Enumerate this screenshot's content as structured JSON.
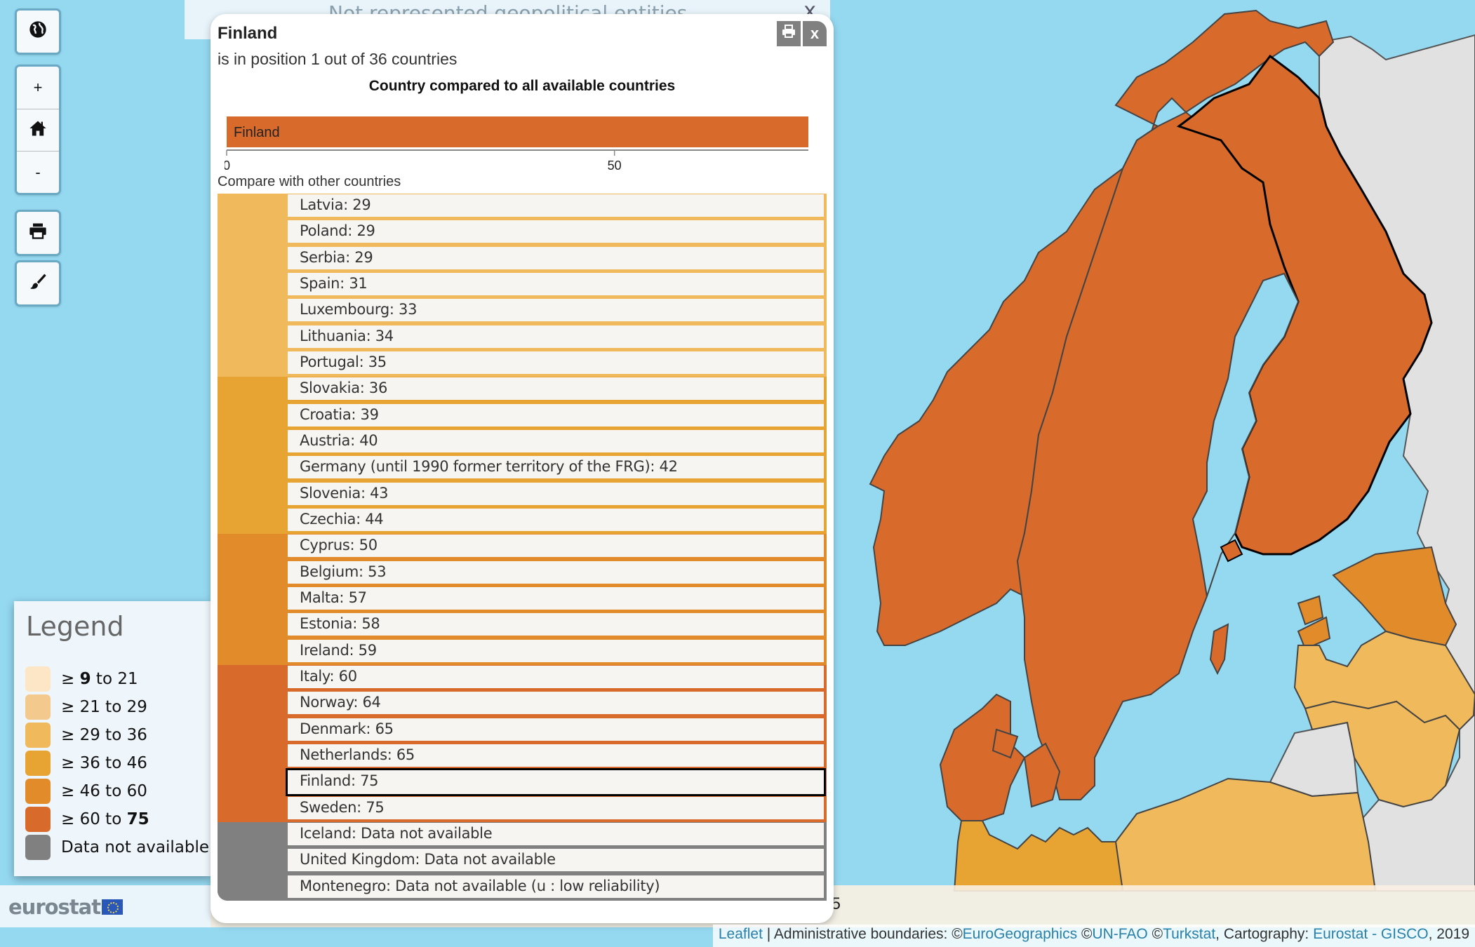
{
  "colors": {
    "sea": "#95d9f1",
    "no_data_land": "#e1e1e1",
    "class_colors": [
      "#fce6c5",
      "#f4c98e",
      "#efb95c",
      "#e8a433",
      "#e18b2a",
      "#d86a2c",
      "#808080"
    ],
    "selected_outline": "#000000",
    "accent": "#d86a2c"
  },
  "map_controls": {
    "globe_icon": "globe-icon",
    "zoom_in_label": "+",
    "home_icon": "home-icon",
    "zoom_out_label": "-",
    "print_icon": "print-icon",
    "style_icon": "paintbrush-icon"
  },
  "background_panel": {
    "text": "Not represented geopolitical entities",
    "close_label": "x"
  },
  "popup": {
    "title": "Finland",
    "subtitle": "is in position 1 out of 36 countries",
    "print_icon": "print-icon",
    "close_label": "x",
    "chart_title": "Country compared to all available countries",
    "compare_label": "Compare with other countries"
  },
  "chart_data": {
    "type": "bar",
    "title": "Country compared to all available countries",
    "categories": [
      "Finland"
    ],
    "values": [
      75
    ],
    "xlim": [
      0,
      75
    ],
    "ticks": [
      0,
      50
    ],
    "xlabel": "",
    "ylabel": ""
  },
  "compare_list": [
    {
      "label": "Latvia: 29",
      "class": 2
    },
    {
      "label": "Poland: 29",
      "class": 2
    },
    {
      "label": "Serbia: 29",
      "class": 2
    },
    {
      "label": "Spain: 31",
      "class": 2
    },
    {
      "label": "Luxembourg: 33",
      "class": 2
    },
    {
      "label": "Lithuania: 34",
      "class": 2
    },
    {
      "label": "Portugal: 35",
      "class": 2
    },
    {
      "label": "Slovakia: 36",
      "class": 3
    },
    {
      "label": "Croatia: 39",
      "class": 3
    },
    {
      "label": "Austria: 40",
      "class": 3
    },
    {
      "label": "Germany (until 1990 former territory of the FRG): 42",
      "class": 3
    },
    {
      "label": "Slovenia: 43",
      "class": 3
    },
    {
      "label": "Czechia: 44",
      "class": 3
    },
    {
      "label": "Cyprus: 50",
      "class": 4
    },
    {
      "label": "Belgium: 53",
      "class": 4
    },
    {
      "label": "Malta: 57",
      "class": 4
    },
    {
      "label": "Estonia: 58",
      "class": 4
    },
    {
      "label": "Ireland: 59",
      "class": 4
    },
    {
      "label": "Italy: 60",
      "class": 5
    },
    {
      "label": "Norway: 64",
      "class": 5
    },
    {
      "label": "Denmark: 65",
      "class": 5
    },
    {
      "label": "Netherlands: 65",
      "class": 5
    },
    {
      "label": "Finland: 75",
      "class": 5,
      "selected": true
    },
    {
      "label": "Sweden: 75",
      "class": 5
    },
    {
      "label": "Iceland: Data not available",
      "class": 6
    },
    {
      "label": "United Kingdom: Data not available",
      "class": 6
    },
    {
      "label": "Montenegro: Data not available (u : low reliability)",
      "class": 6
    }
  ],
  "legend": {
    "title": "Legend",
    "items": [
      {
        "prefix": "≥ ",
        "from": "9",
        "from_bold": true,
        "mid": " to ",
        "to": "21",
        "to_bold": false
      },
      {
        "prefix": "≥ ",
        "from": "21",
        "from_bold": false,
        "mid": " to ",
        "to": "29",
        "to_bold": false
      },
      {
        "prefix": "≥ ",
        "from": "29",
        "from_bold": false,
        "mid": " to ",
        "to": "36",
        "to_bold": false
      },
      {
        "prefix": "≥ ",
        "from": "36",
        "from_bold": false,
        "mid": " to ",
        "to": "46",
        "to_bold": false
      },
      {
        "prefix": "≥ ",
        "from": "46",
        "from_bold": false,
        "mid": " to ",
        "to": "60",
        "to_bold": false
      },
      {
        "prefix": "≥ ",
        "from": "60",
        "from_bold": false,
        "mid": " to ",
        "to": "75",
        "to_bold": true
      },
      {
        "prefix": "",
        "from": "Data not available",
        "from_bold": false,
        "mid": "",
        "to": "",
        "to_bold": false
      }
    ]
  },
  "footer": {
    "logo_text": "eurostat",
    "stray_text": "'5"
  },
  "attribution": {
    "leaflet": "Leaflet",
    "separator": " | ",
    "admin_prefix": "Administrative boundaries: ©",
    "eurogeographics": "EuroGeographics",
    "copy1": " ©",
    "unfao": "UN-FAO",
    "copy2": " ©",
    "turkstat": "Turkstat",
    "cartography_prefix": ", Cartography: ",
    "eurostat_gisco": "Eurostat - GISCO",
    "year": ", 2019"
  },
  "map_regions": [
    {
      "name": "Norway",
      "class": 5
    },
    {
      "name": "Sweden",
      "class": 5
    },
    {
      "name": "Finland",
      "class": 5,
      "selected": true
    },
    {
      "name": "Denmark",
      "class": 5
    },
    {
      "name": "Estonia",
      "class": 4
    },
    {
      "name": "Latvia",
      "class": 2
    },
    {
      "name": "Lithuania",
      "class": 2
    },
    {
      "name": "Poland",
      "class": 2
    },
    {
      "name": "Germany",
      "class": 3
    },
    {
      "name": "Russia",
      "class": "none"
    },
    {
      "name": "Belarus",
      "class": "none"
    },
    {
      "name": "Kaliningrad",
      "class": "none"
    }
  ]
}
